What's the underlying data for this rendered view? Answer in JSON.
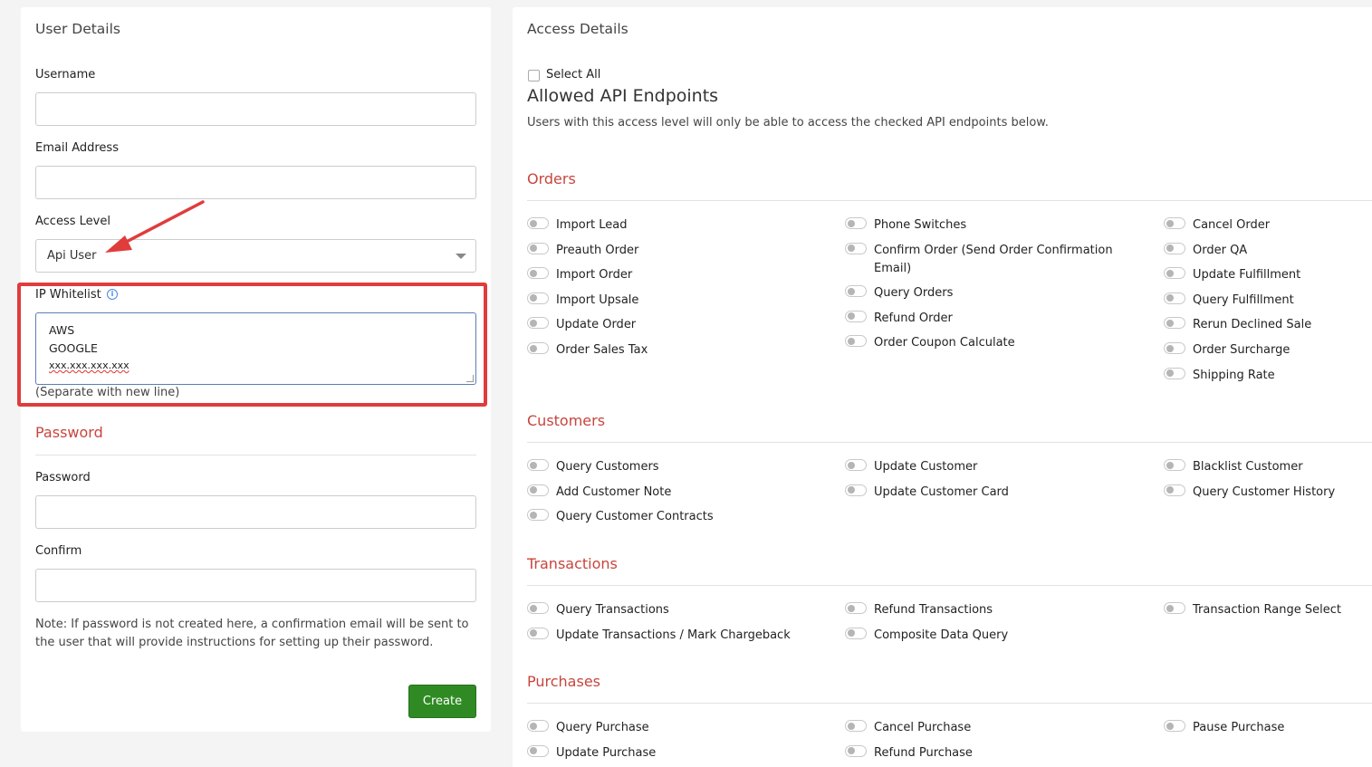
{
  "user_details": {
    "title": "User Details",
    "username_label": "Username",
    "email_label": "Email Address",
    "access_level_label": "Access Level",
    "access_level_value": "Api User",
    "ip_whitelist_label": "IP Whitelist",
    "ip_whitelist_lines": [
      "AWS",
      "GOOGLE",
      "xxx.xxx.xxx.xxx"
    ],
    "ip_whitelist_helper": "(Separate with new line)",
    "password_section": "Password",
    "password_label": "Password",
    "confirm_label": "Confirm",
    "note": "Note: If password is not created here, a confirmation email will be sent to the user that will provide instructions for setting up their password.",
    "create_label": "Create"
  },
  "access_details": {
    "title": "Access Details",
    "select_all_label": "Select All",
    "endpoints_title": "Allowed API Endpoints",
    "endpoints_desc": "Users with this access level will only be able to access the checked API endpoints below.",
    "sections": [
      {
        "name": "Orders",
        "columns": [
          [
            "Import Lead",
            "Preauth Order",
            "Import Order",
            "Import Upsale",
            "Update Order",
            "Order Sales Tax"
          ],
          [
            "Phone Switches",
            "Confirm Order (Send Order Confirmation Email)",
            "Query Orders",
            "Refund Order",
            "Order Coupon Calculate"
          ],
          [
            "Cancel Order",
            "Order QA",
            "Update Fulfillment",
            "Query Fulfillment",
            "Rerun Declined Sale",
            "Order Surcharge",
            "Shipping Rate"
          ]
        ]
      },
      {
        "name": "Customers",
        "columns": [
          [
            "Query Customers",
            "Add Customer Note",
            "Query Customer Contracts"
          ],
          [
            "Update Customer",
            "Update Customer Card"
          ],
          [
            "Blacklist Customer",
            "Query Customer History"
          ]
        ]
      },
      {
        "name": "Transactions",
        "columns": [
          [
            "Query Transactions",
            "Update Transactions / Mark Chargeback"
          ],
          [
            "Refund Transactions",
            "Composite Data Query"
          ],
          [
            "Transaction Range Select"
          ]
        ]
      },
      {
        "name": "Purchases",
        "columns": [
          [
            "Query Purchase",
            "Update Purchase"
          ],
          [
            "Cancel Purchase",
            "Refund Purchase"
          ],
          [
            "Pause Purchase"
          ]
        ]
      }
    ]
  },
  "colors": {
    "accent_red": "#c8453d",
    "highlight_red": "#e03c3c",
    "create_green": "#2f8a23",
    "info_blue": "#4a86e8"
  },
  "icons": [
    "info-icon",
    "chevron-down-icon",
    "arrow-annotation-icon",
    "toggle-icon",
    "checkbox-icon"
  ]
}
